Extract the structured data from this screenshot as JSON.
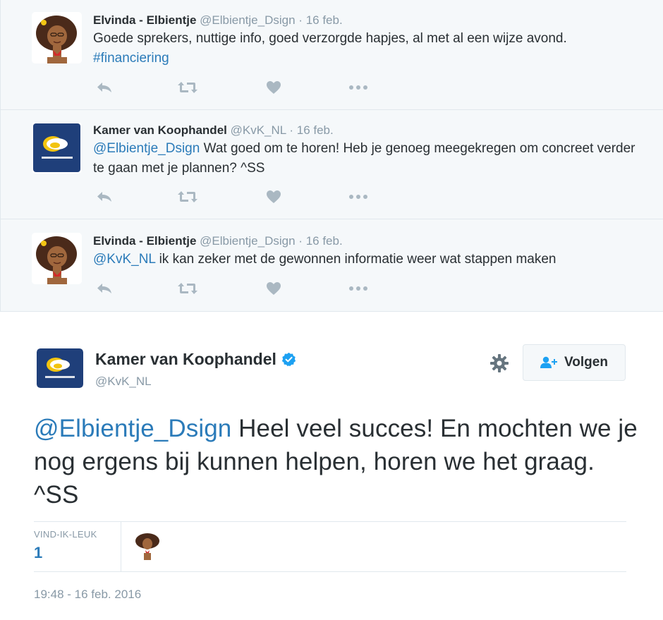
{
  "replies": [
    {
      "author": "Elvinda - Elbientje",
      "handle": "@Elbientje_Dsign",
      "separator": "·",
      "date": "16 feb.",
      "avatar": "elbientje-avatar",
      "text_plain": "Goede sprekers, nuttige info, goed verzorgde hapjes, al met al een wijze avond.",
      "text_link": "#financiering"
    },
    {
      "author": "Kamer van Koophandel",
      "handle": "@KvK_NL",
      "separator": "·",
      "date": "16 feb.",
      "avatar": "kvk-logo-avatar",
      "text_link": "@Elbientje_Dsign",
      "text_plain": " Wat goed om te horen! Heb je genoeg meegekregen om concreet verder te gaan met je plannen? ^SS"
    },
    {
      "author": "Elvinda - Elbientje",
      "handle": "@Elbientje_Dsign",
      "separator": "·",
      "date": "16 feb.",
      "avatar": "elbientje-avatar",
      "text_link": "@KvK_NL",
      "text_plain": " ik kan zeker met de gewonnen informatie weer wat stappen maken"
    }
  ],
  "actions": {
    "reply_icon": "reply-icon",
    "retweet_icon": "retweet-icon",
    "like_icon": "heart-icon",
    "more_icon": "more-dots-icon"
  },
  "main_tweet": {
    "author": "Kamer van Koophandel",
    "handle": "@KvK_NL",
    "verified": true,
    "follow_label": "Volgen",
    "mention": "@Elbientje_Dsign",
    "text": " Heel veel succes! En mochten we je nog ergens bij kunnen helpen, horen we het graag. ^SS",
    "likes_label": "VIND-IK-LEUK",
    "likes_count": "1",
    "timestamp": "19:48 - 16 feb. 2016"
  },
  "colors": {
    "link": "#2b7bb9",
    "muted": "#8899a6",
    "text": "#292f33",
    "thread_bg": "#f5f8fa",
    "border": "#e1e8ed",
    "verified": "#1da1f2",
    "kvk_navy": "#1f3f7a"
  }
}
